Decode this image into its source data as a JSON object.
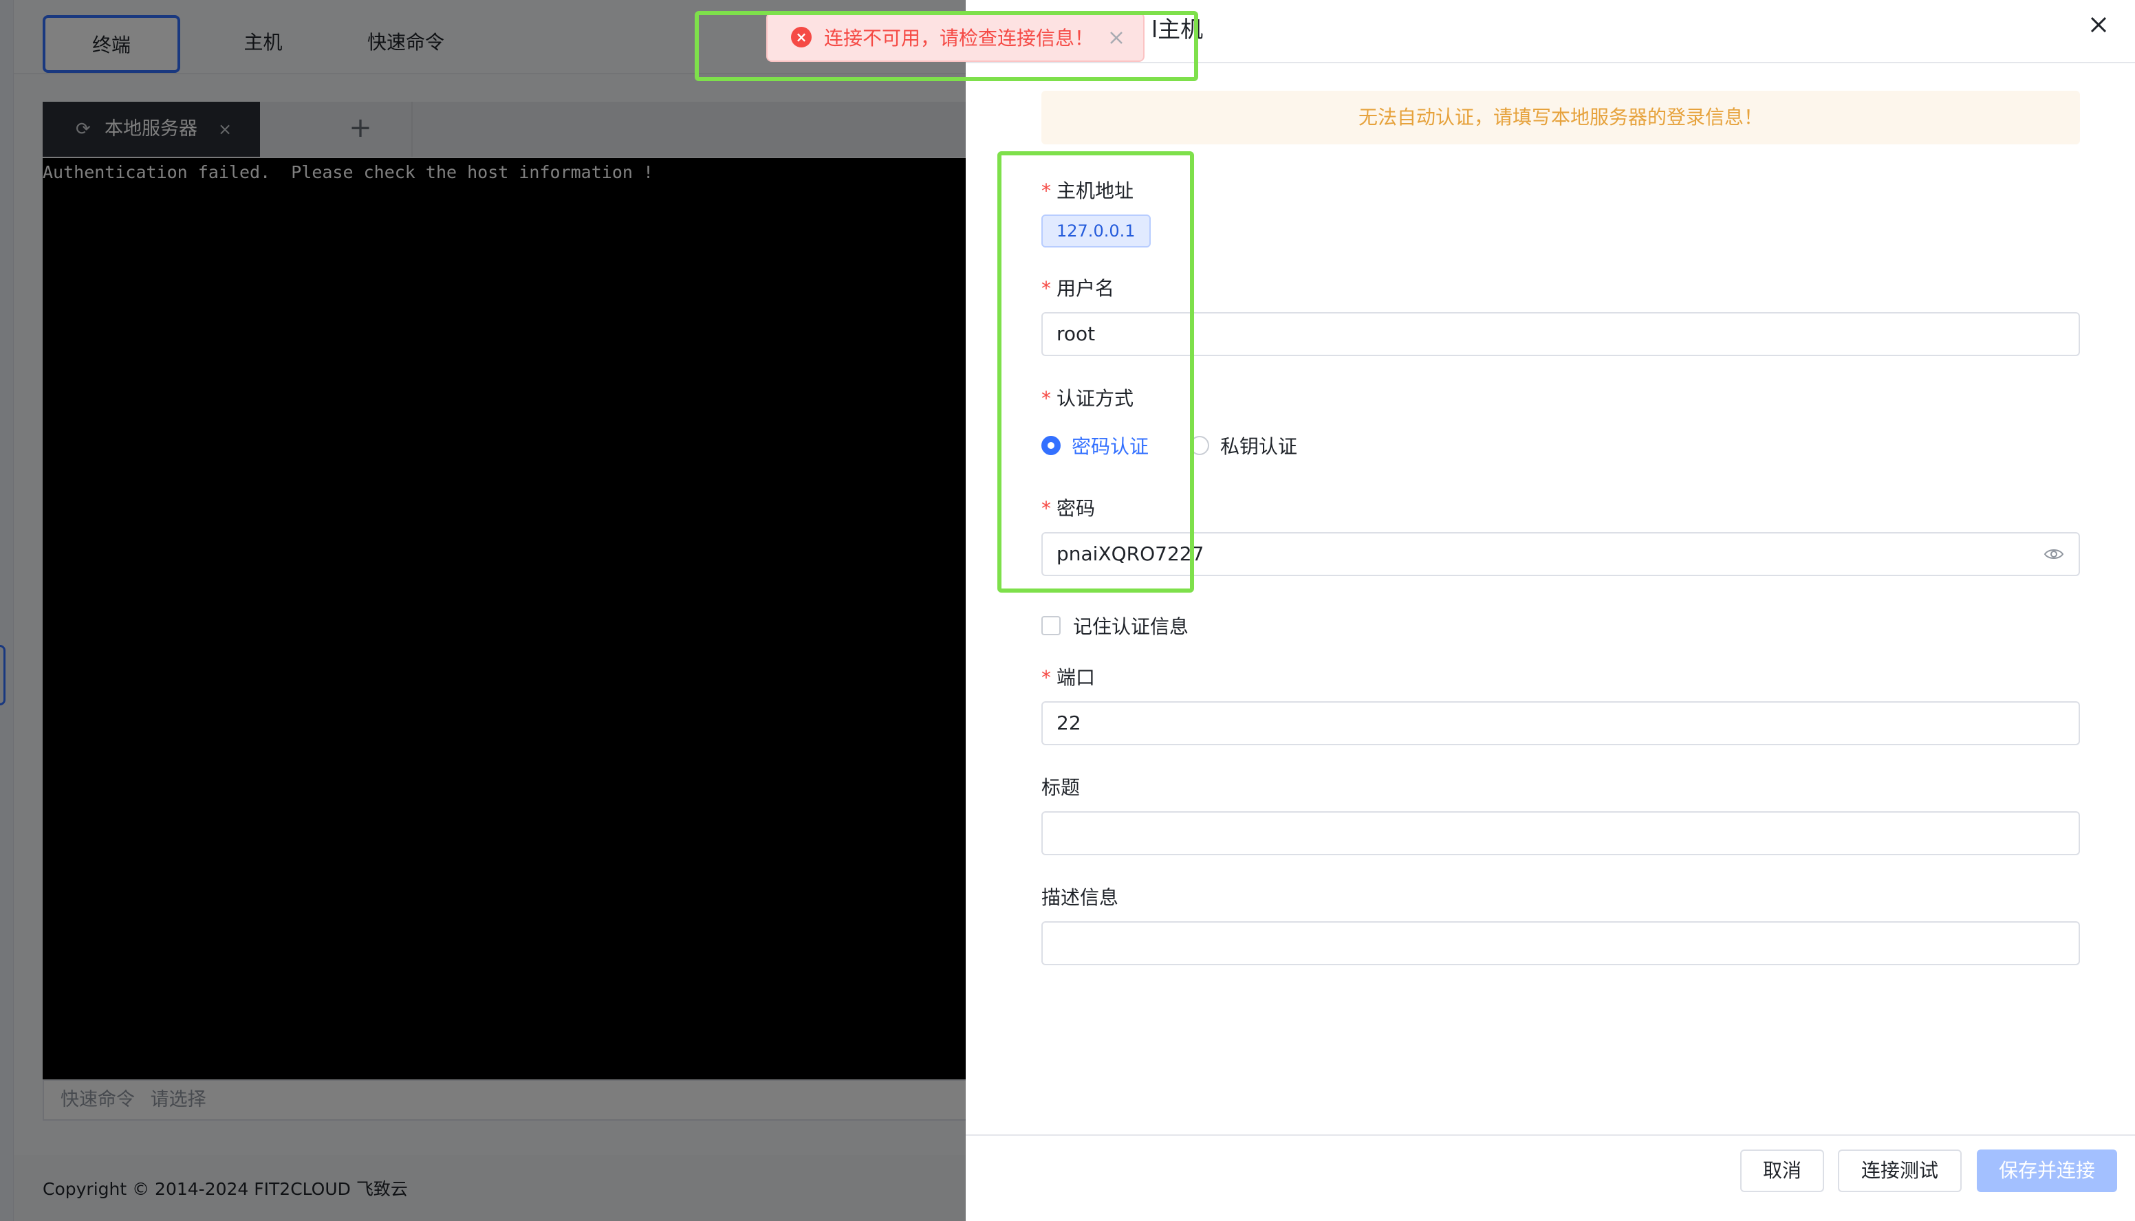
{
  "app": {
    "top_tabs": [
      {
        "label": "终端",
        "active": true
      },
      {
        "label": "主机",
        "active": false
      },
      {
        "label": "快速命令",
        "active": false
      }
    ],
    "terminal_tab": {
      "label": "本地服务器",
      "icon": "refresh-icon",
      "close": "×"
    },
    "add_tab": "+",
    "terminal_output": "Authentication failed.  Please check the host information !",
    "quick_command": {
      "label": "快速命令",
      "placeholder": "请选择"
    },
    "copyright": "Copyright © 2014-2024 FIT2CLOUD 飞致云"
  },
  "drawer": {
    "title_fragment": "l主机",
    "alert": "无法自动认证，请填写本地服务器的登录信息！",
    "host": {
      "label": "主机地址",
      "value": "127.0.0.1"
    },
    "username": {
      "label": "用户名",
      "value": "root"
    },
    "auth": {
      "label": "认证方式",
      "options": [
        "密码认证",
        "私钥认证"
      ],
      "selected": "密码认证"
    },
    "password": {
      "label": "密码",
      "value": "pnaiXQRO7227"
    },
    "remember": {
      "label": "记住认证信息",
      "checked": false
    },
    "port": {
      "label": "端口",
      "value": "22"
    },
    "title_field": {
      "label": "标题",
      "value": ""
    },
    "description": {
      "label": "描述信息",
      "value": ""
    },
    "buttons": {
      "cancel": "取消",
      "test": "连接测试",
      "save": "保存并连接"
    }
  },
  "toast": {
    "message": "连接不可用，请检查连接信息！",
    "type": "error"
  },
  "colors": {
    "primary": "#3370ff",
    "error": "#f54a45",
    "warning": "#e6a23c",
    "highlight": "#7ee04b"
  }
}
